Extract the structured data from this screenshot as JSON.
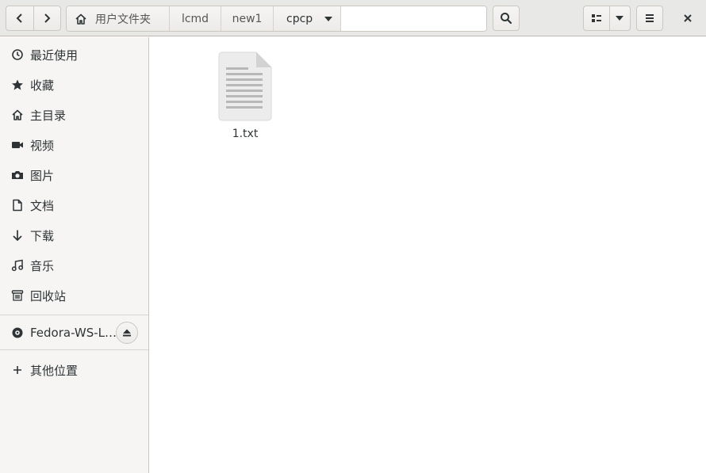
{
  "header": {
    "nav": {
      "back_icon": "chevron-left-icon",
      "forward_icon": "chevron-right-icon"
    },
    "pathbar": {
      "crumbs": [
        "用户文件夹",
        "lcmd",
        "new1",
        "cpcp"
      ],
      "home_icon": "home-icon",
      "dropdown_icon": "triangle-down-icon"
    },
    "search_icon": "search-icon",
    "view_icon": "list-view-icon",
    "view_dropdown_icon": "triangle-down-icon",
    "menu_icon": "hamburger-menu-icon",
    "close_icon": "close-icon"
  },
  "sidebar": {
    "items": [
      {
        "label": "最近使用",
        "icon": "clock-icon"
      },
      {
        "label": "收藏",
        "icon": "star-icon"
      },
      {
        "label": "主目录",
        "icon": "home-icon"
      },
      {
        "label": "视频",
        "icon": "video-camera-icon"
      },
      {
        "label": "图片",
        "icon": "camera-icon"
      },
      {
        "label": "文档",
        "icon": "document-icon"
      },
      {
        "label": "下载",
        "icon": "download-arrow-icon"
      },
      {
        "label": "音乐",
        "icon": "music-note-icon"
      },
      {
        "label": "回收站",
        "icon": "trash-icon"
      }
    ],
    "devices": [
      {
        "label": "Fedora-WS-L…",
        "icon": "optical-disc-icon",
        "eject_icon": "eject-icon"
      }
    ],
    "other": {
      "label": "其他位置",
      "icon": "plus-icon"
    }
  },
  "main": {
    "files": [
      {
        "name": "1.txt",
        "icon": "text-file-icon"
      }
    ]
  }
}
